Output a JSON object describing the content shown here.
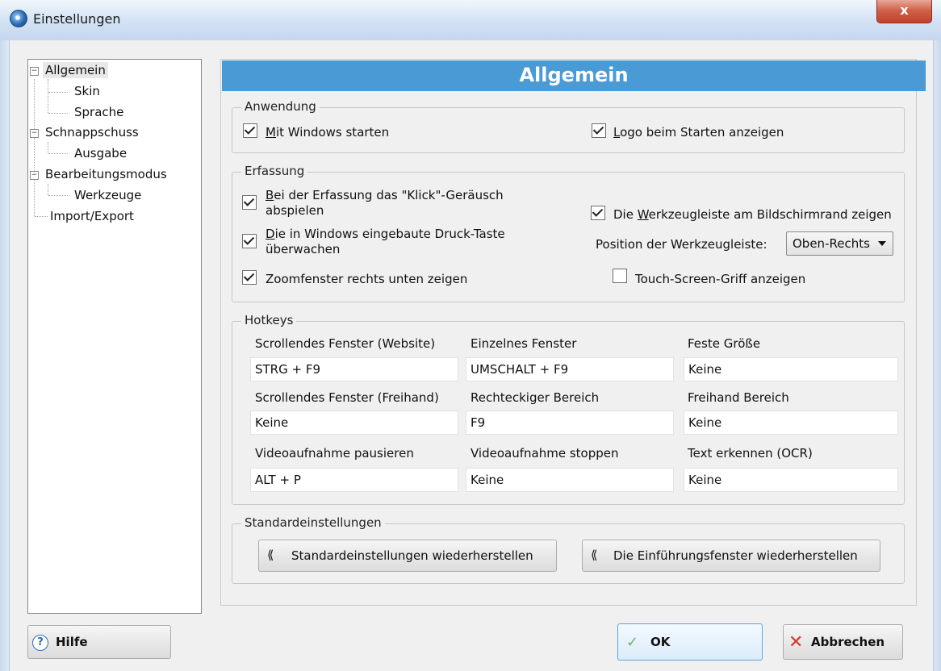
{
  "window": {
    "title": "Einstellungen",
    "close_label": "x"
  },
  "tree": {
    "items": [
      {
        "label": "Allgemein",
        "expander": "−"
      },
      {
        "label": "Skin"
      },
      {
        "label": "Sprache"
      },
      {
        "label": "Schnappschuss",
        "expander": "−"
      },
      {
        "label": "Ausgabe"
      },
      {
        "label": "Bearbeitungsmodus",
        "expander": "−"
      },
      {
        "label": "Werkzeuge"
      },
      {
        "label": "Import/Export"
      }
    ]
  },
  "header": {
    "title": "Allgemein"
  },
  "anwendung": {
    "title": "Anwendung",
    "mit_windows": {
      "label_u": "M",
      "label_rest": "it Windows starten",
      "checked": true
    },
    "logo": {
      "label_u": "L",
      "label_rest": "ogo beim Starten anzeigen",
      "checked": true
    }
  },
  "erfassung": {
    "title": "Erfassung",
    "klick": {
      "label_u": "B",
      "line1_rest": "ei der Erfassung das \"Klick\"-Geräusch",
      "line2": "abspielen",
      "checked": true
    },
    "druck": {
      "label_u": "D",
      "line1_rest": "ie in Windows eingebaute Druck-Taste",
      "line2": "überwachen",
      "checked": true
    },
    "zoom": {
      "label": "Zoomfenster rechts unten zeigen",
      "checked": true
    },
    "werkzeugleiste": {
      "label_pre": "Die ",
      "label_u": "W",
      "label_rest": "erkzeugleiste am Bildschirmrand zeigen",
      "checked": true
    },
    "position_label": "Position der Werkzeugleiste:",
    "position_value": "Oben-Rechts",
    "touch": {
      "label": "Touch-Screen-Griff anzeigen",
      "checked": false
    }
  },
  "hotkeys": {
    "title": "Hotkeys",
    "rows": [
      [
        {
          "label": "Scrollendes Fenster (Website)",
          "value": "STRG + F9"
        },
        {
          "label": "Einzelnes Fenster",
          "value": "UMSCHALT + F9"
        },
        {
          "label": "Feste Größe",
          "value": "Keine"
        }
      ],
      [
        {
          "label": "Scrollendes Fenster (Freihand)",
          "value": "Keine"
        },
        {
          "label": "Rechteckiger Bereich",
          "value": "F9"
        },
        {
          "label": "Freihand Bereich",
          "value": "Keine"
        }
      ],
      [
        {
          "label": "Videoaufnahme pausieren",
          "value": "ALT + P"
        },
        {
          "label": "Videoaufnahme stoppen",
          "value": "Keine"
        },
        {
          "label": "Text erkennen (OCR)",
          "value": "Keine"
        }
      ]
    ]
  },
  "standard": {
    "title": "Standardeinstellungen",
    "restore_settings": "Standardeinstellungen wiederherstellen",
    "restore_intro": "Die Einführungsfenster wiederherstellen"
  },
  "footer": {
    "help": "Hilfe",
    "ok": "OK",
    "cancel": "Abbrechen"
  }
}
